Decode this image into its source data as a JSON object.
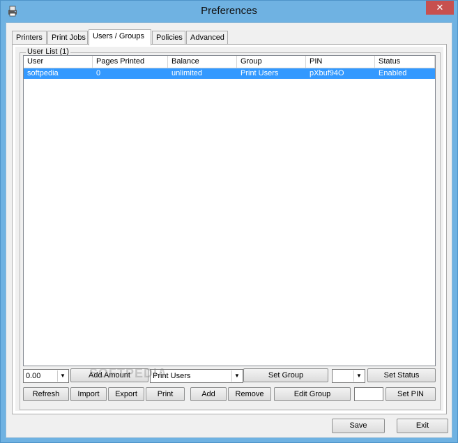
{
  "window": {
    "title": "Preferences",
    "close_glyph": "✕"
  },
  "tabs": [
    {
      "label": "Printers"
    },
    {
      "label": "Print Jobs"
    },
    {
      "label": "Users / Groups"
    },
    {
      "label": "Policies"
    },
    {
      "label": "Advanced"
    }
  ],
  "user_list": {
    "label": "User List (1)",
    "columns": [
      "User",
      "Pages Printed",
      "Balance",
      "Group",
      "PIN",
      "Status"
    ],
    "rows": [
      [
        "softpedia",
        "0",
        "unlimited",
        "Print Users",
        "pXbuf94O",
        "Enabled"
      ]
    ]
  },
  "controls": {
    "amount_value": "0.00",
    "add_amount": "Add Amount",
    "group_value": "Print Users",
    "set_group": "Set Group",
    "status_value": "",
    "set_status": "Set Status",
    "refresh": "Refresh",
    "import": "Import",
    "export": "Export",
    "print": "Print",
    "add": "Add",
    "remove": "Remove",
    "edit_group": "Edit Group",
    "pin_value": "",
    "set_pin": "Set PIN"
  },
  "footer": {
    "save": "Save",
    "exit": "Exit"
  },
  "watermark": "SOFTPEDIA"
}
